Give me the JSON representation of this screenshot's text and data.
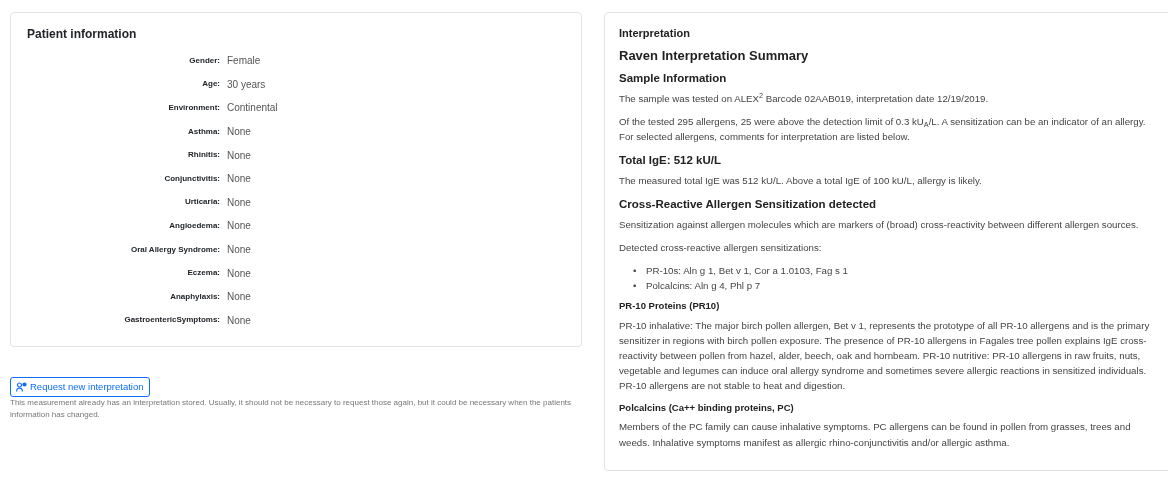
{
  "patient_card": {
    "title": "Patient information",
    "fields": [
      {
        "label": "Gender:",
        "value": "Female"
      },
      {
        "label": "Age:",
        "value": "30 years"
      },
      {
        "label": "Environment:",
        "value": "Continental"
      },
      {
        "label": "Asthma:",
        "value": "None"
      },
      {
        "label": "Rhinitis:",
        "value": "None"
      },
      {
        "label": "Conjunctivitis:",
        "value": "None"
      },
      {
        "label": "Urticaria:",
        "value": "None"
      },
      {
        "label": "Angioedema:",
        "value": "None"
      },
      {
        "label": "Oral Allergy Syndrome:",
        "value": "None"
      },
      {
        "label": "Eczema:",
        "value": "None"
      },
      {
        "label": "Anaphylaxis:",
        "value": "None"
      },
      {
        "label": "GastroentericSymptoms:",
        "value": "None"
      }
    ]
  },
  "request_button": {
    "label": "Request new interpretation"
  },
  "request_note": "This measurement already has an interpretation stored. Usually, it should not be necessary to request those again, but it could be necessary when the patients information has changed.",
  "interpretation_card": {
    "title": "Interpretation",
    "blocks": [
      {
        "kind": "title",
        "text": "Raven Interpretation Summary"
      },
      {
        "kind": "heading",
        "text": "Sample Information"
      },
      {
        "kind": "paragraph",
        "text": "The sample was tested on ALEX$^{2}$ Barcode 02AAB019, interpretation date 12/19/2019."
      },
      {
        "kind": "paragraph",
        "text": "Of the tested 295 allergens, 25 were above the detection limit of 0.3 kU$_{A}$/L. A sensitization can be an indicator of an allergy. For selected allergens, comments for interpretation are listed below."
      },
      {
        "kind": "heading",
        "text": "Total IgE: 512 kU/L"
      },
      {
        "kind": "paragraph",
        "text": "The measured total IgE was 512 kU/L. Above a total IgE of 100 kU/L, allergy is likely."
      },
      {
        "kind": "heading",
        "text": "Cross-Reactive Allergen Sensitization detected"
      },
      {
        "kind": "paragraph",
        "text": "Sensitization against allergen molecules which are markers of (broad) cross-reactivity between different allergen sources."
      },
      {
        "kind": "paragraph",
        "text": "Detected cross-reactive allergen sensitizations:"
      },
      {
        "kind": "bullets",
        "items": [
          {
            "marker": "•",
            "text": "PR-10s: Aln g 1, Bet v 1, Cor a 1.0103, Fag s 1"
          },
          {
            "marker": "•",
            "text": "Polcalcins: Aln g 4, Phl p 7"
          }
        ]
      },
      {
        "kind": "subheading",
        "text": "PR-10 Proteins (PR10)"
      },
      {
        "kind": "paragraph",
        "text": "PR-10 inhalative: The major birch pollen allergen, Bet v 1, represents the prototype of all PR-10 allergens and is the primary sensitizer in regions with birch pollen exposure. The presence of PR-10 allergens in Fagales tree pollen explains IgE cross-reactivity between pollen from hazel, alder, beech, oak and hornbeam. PR-10 nutritive: PR-10 allergens in raw fruits, nuts, vegetable and legumes can induce oral allergy syndrome and sometimes severe allergic reactions in sensitized individuals. PR-10 allergens are not stable to heat and digestion."
      },
      {
        "kind": "subheading",
        "text": "Polcalcins (Ca++ binding proteins, PC)"
      },
      {
        "kind": "paragraph",
        "text": "Members of the PC family can cause inhalative symptoms. PC allergens can be found in pollen from grasses, trees and weeds. Inhalative symptoms manifest as allergic rhino-conjunctivitis and/or allergic asthma."
      }
    ]
  }
}
